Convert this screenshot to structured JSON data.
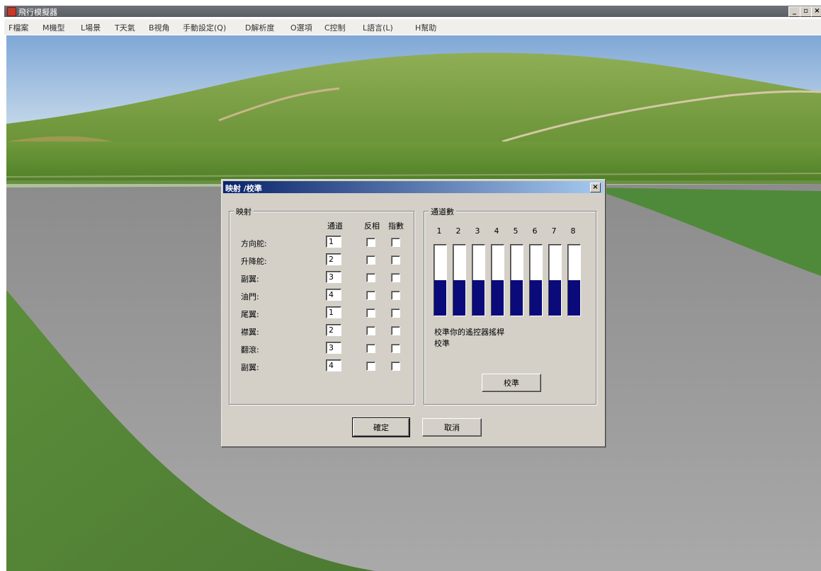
{
  "window": {
    "title": "飛行模擬器",
    "buttons": {
      "minimize": "_",
      "maximize": "▫",
      "close": "×"
    }
  },
  "menu": [
    "F檔案",
    "M機型",
    "L場景",
    "T天氣",
    "B視角",
    "手動設定(Q)",
    "D解析度",
    "O選項",
    "C控制",
    "L語言(L)",
    "H幫助"
  ],
  "dialog": {
    "title": "映射 /校準",
    "close_label": "×",
    "mapping": {
      "group_title": "映射",
      "headers": {
        "channel": "通道",
        "reverse": "反相",
        "map": "指數"
      },
      "rows": [
        {
          "label": "方向舵:",
          "channel": "1"
        },
        {
          "label": "升降舵:",
          "channel": "2"
        },
        {
          "label": "副翼:",
          "channel": "3"
        },
        {
          "label": "油門:",
          "channel": "4"
        },
        {
          "label": "尾翼:",
          "channel": "1"
        },
        {
          "label": "襟翼:",
          "channel": "2"
        },
        {
          "label": "翻滾:",
          "channel": "3"
        },
        {
          "label": "副翼:",
          "channel": "4"
        }
      ]
    },
    "channels": {
      "group_title": "通道數",
      "numbers": [
        "1",
        "2",
        "3",
        "4",
        "5",
        "6",
        "7",
        "8"
      ],
      "levels": [
        0.5,
        0.5,
        0.5,
        0.5,
        0.5,
        0.5,
        0.5,
        0.5
      ],
      "fill_color": "#0a0a7a",
      "note_line1": "校準你的遙控器搖桿",
      "note_line2": "校準",
      "calibrate_label": "校準"
    },
    "ok_label": "確定",
    "cancel_label": "取消"
  }
}
